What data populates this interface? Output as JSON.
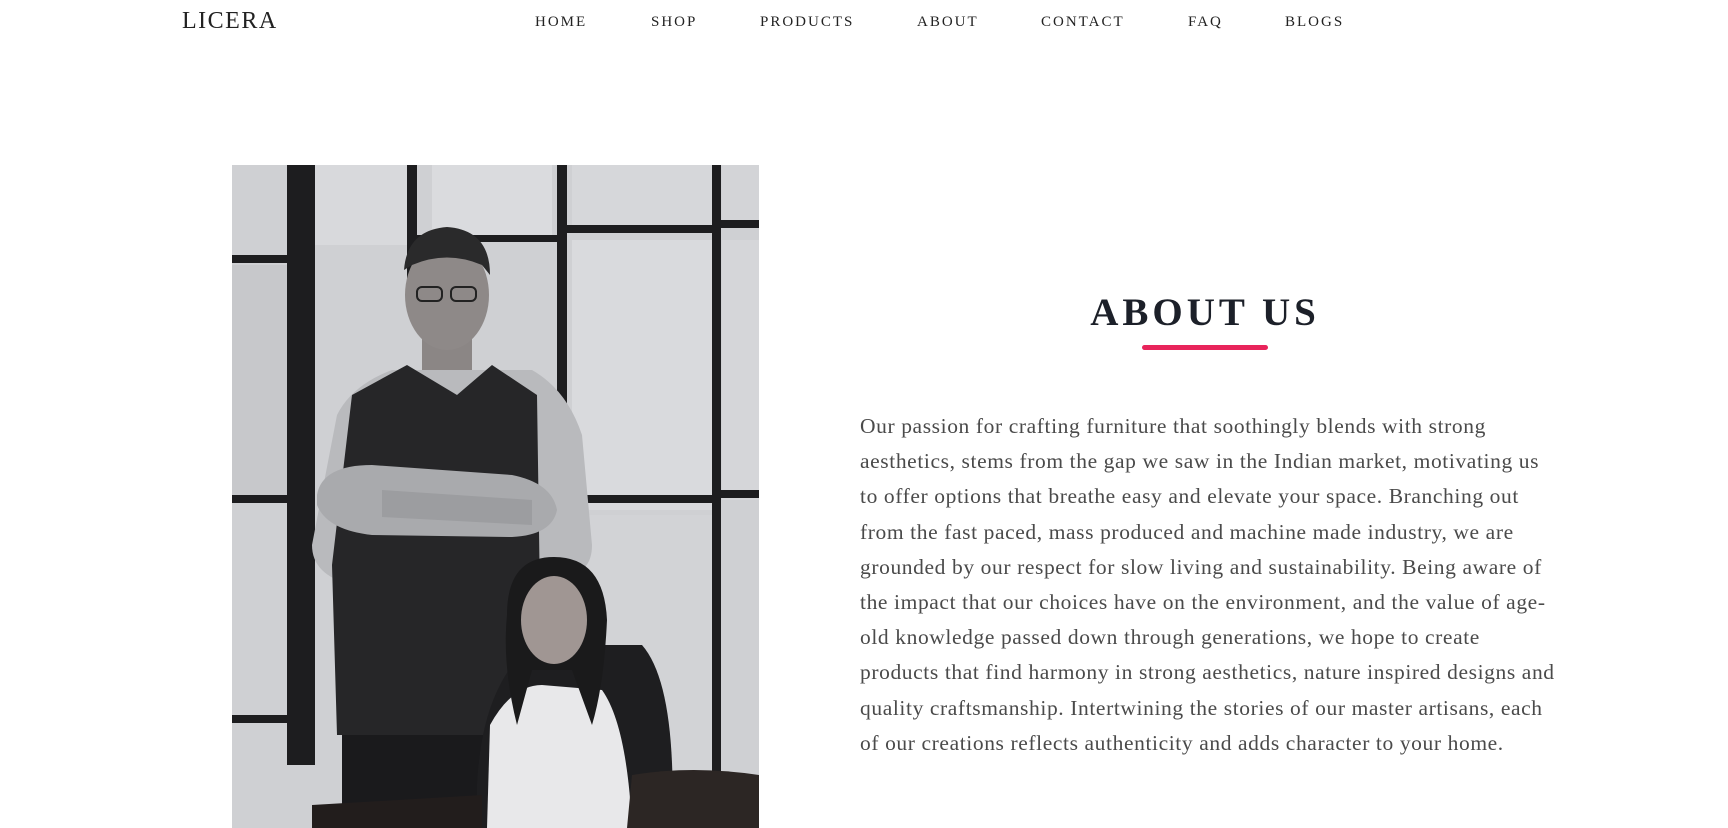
{
  "header": {
    "logo": "LICERA",
    "nav": [
      "HOME",
      "SHOP",
      "PRODUCTS",
      "ABOUT",
      "CONTACT",
      "FAQ",
      "BLOGS"
    ]
  },
  "about": {
    "title": "ABOUT US",
    "body": "Our passion for crafting furniture that soothingly blends with strong aesthetics, stems from the gap we saw in the Indian market, motivating us to offer options that breathe easy and elevate your space. Branching out from the fast paced, mass produced and machine made industry, we are grounded by our respect for slow living and sustainability. Being aware of the impact that our choices have on the environment, and the value of age-old knowledge passed down through generations, we hope to create products that find harmony in strong aesthetics, nature inspired designs and quality craftsmanship. Intertwining the stories of our master artisans, each of our creations reflects authenticity and adds character to your home."
  },
  "colors": {
    "accent": "#e8245b",
    "title": "#1c2029",
    "body_text": "#4a4a4a"
  }
}
